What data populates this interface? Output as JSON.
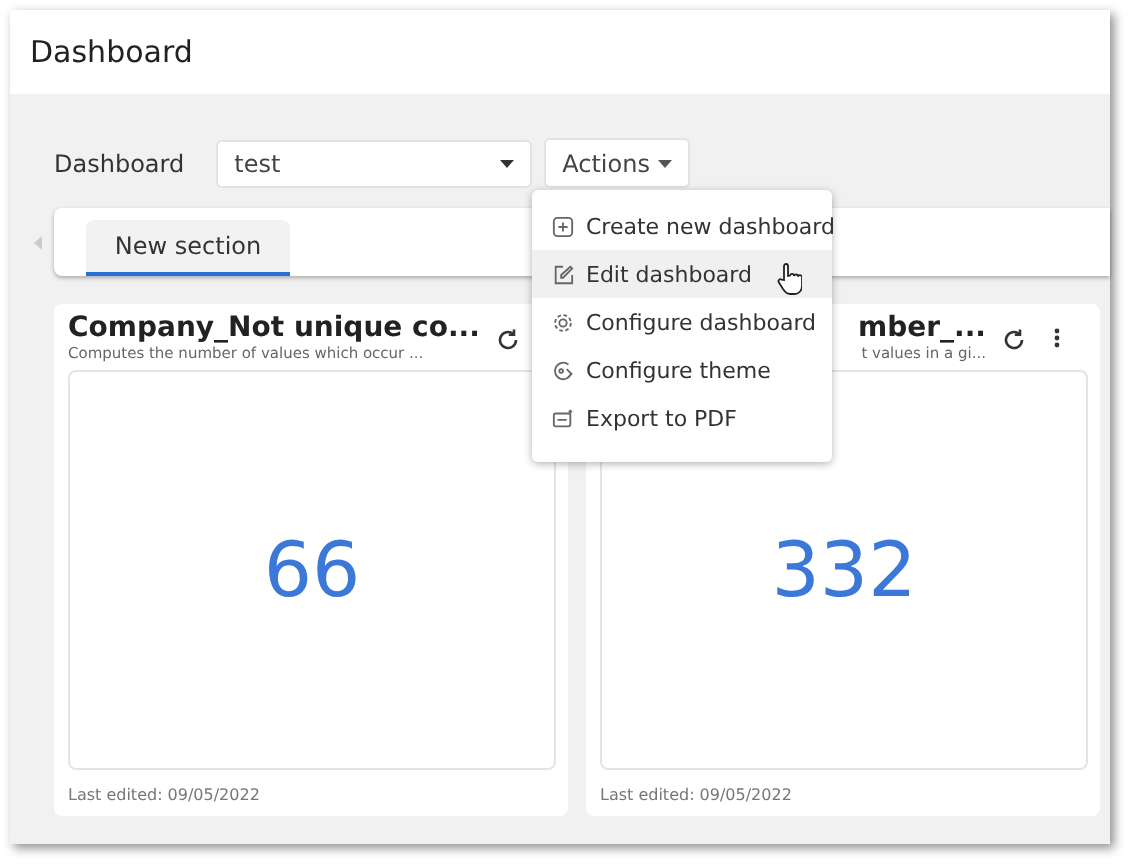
{
  "window": {
    "title": "Dashboard"
  },
  "toolbar": {
    "label": "Dashboard",
    "select_value": "test",
    "actions_label": "Actions"
  },
  "menu": {
    "items": [
      {
        "kind": "plus",
        "label": "Create new dashboard",
        "selected": false
      },
      {
        "kind": "edit",
        "label": "Edit dashboard",
        "selected": true
      },
      {
        "kind": "gear",
        "label": "Configure dashboard",
        "selected": false
      },
      {
        "kind": "theme",
        "label": "Configure theme",
        "selected": false
      },
      {
        "kind": "pdf",
        "label": "Export to PDF",
        "selected": false
      }
    ]
  },
  "tabs": [
    {
      "label": "New section",
      "selected": true
    }
  ],
  "cards": [
    {
      "title": "Company_Not unique co...",
      "description": "Computes the number of values which occur ...",
      "value": "66",
      "footer": "Last edited: 09/05/2022",
      "cut_left": false
    },
    {
      "title": "mber_...",
      "description": "t values in a gi...",
      "value": "332",
      "footer": "Last edited: 09/05/2022",
      "cut_left": true
    }
  ]
}
